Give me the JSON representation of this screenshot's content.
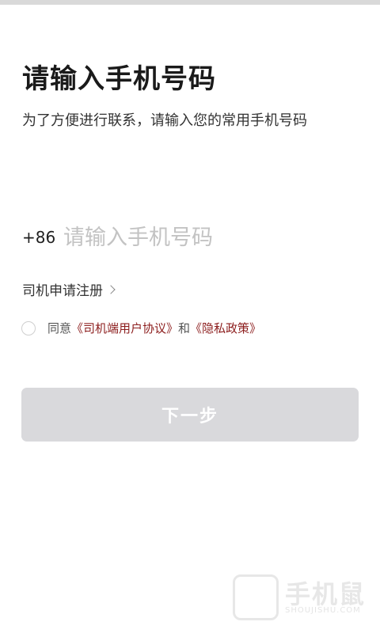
{
  "header": {
    "title": "请输入手机号码",
    "subtitle": "为了方便进行联系，请输入您的常用手机号码"
  },
  "phone": {
    "country_code": "+86",
    "placeholder": "请输入手机号码",
    "value": ""
  },
  "register": {
    "label": "司机申请注册"
  },
  "agreement": {
    "prefix": "同意",
    "user_agreement": "《司机端用户协议》",
    "conjunction": "和",
    "privacy_policy": "《隐私政策》",
    "checked": false,
    "link_color": "#8c1d1d"
  },
  "next_button": {
    "label": "下一步",
    "enabled": false
  },
  "watermark": {
    "text": "手机鼠",
    "sub": "SHOUJISHU.COM"
  }
}
